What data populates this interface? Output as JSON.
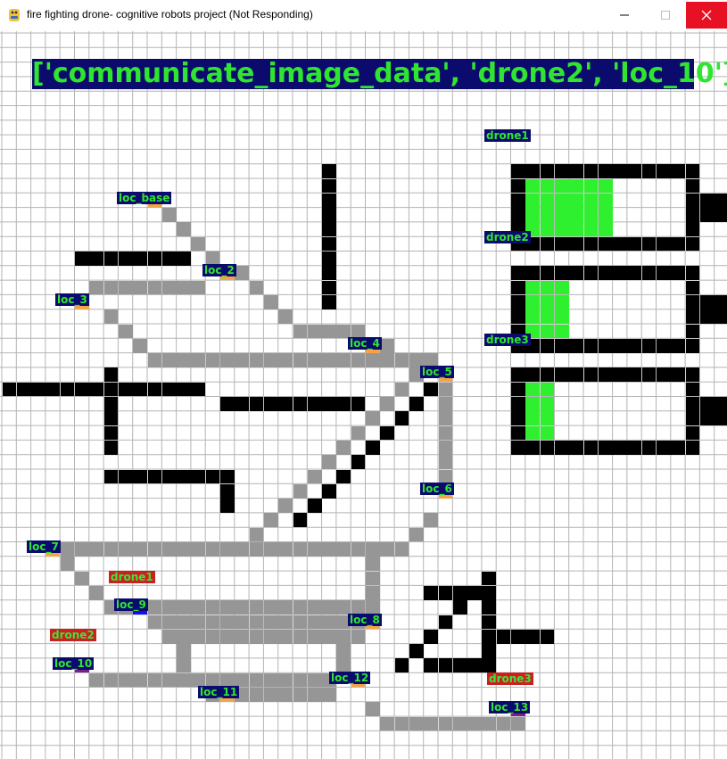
{
  "window": {
    "title": "fire fighting drone- cognitive robots project (Not Responding)",
    "minimize_icon": "minimize-icon",
    "maximize_icon": "maximize-icon",
    "close_icon": "close-icon"
  },
  "action": "['communicate_image_data', 'drone2', 'loc_10']",
  "colors": {
    "grid_line": "#b4b4b4",
    "wall": "#000000",
    "path": "#969696",
    "location": "#f5a442",
    "label_bg": "#0b0b6e",
    "label_text": "#2fe52f",
    "drone_tag_bg": "#cc1f1f",
    "battery_fill": "#2ef02e",
    "drone_blue": "#1010ee",
    "drone_purple": "#7a1f8a"
  },
  "locations": [
    "loc_base",
    "loc_2",
    "loc_3",
    "loc_4",
    "loc_5",
    "loc_6",
    "loc_7",
    "loc_8",
    "loc_9",
    "loc_10",
    "loc_11",
    "loc_12",
    "loc_13"
  ],
  "drones": [
    {
      "name": "drone1",
      "location": "loc_9",
      "color": "blue",
      "battery": 0.57
    },
    {
      "name": "drone2",
      "location": "loc_10",
      "color": "purple",
      "battery": 0.29
    },
    {
      "name": "drone3",
      "location": "loc_13",
      "color": "purple",
      "battery": 0.19
    }
  ]
}
